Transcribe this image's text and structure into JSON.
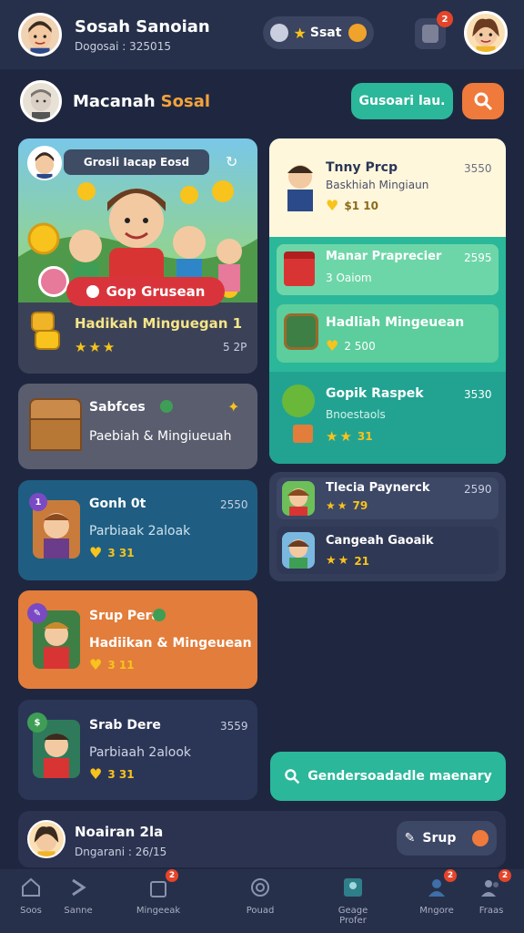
{
  "header": {
    "title": "Sosah Sanoian",
    "subtitle": "Dogosai : 325015",
    "status_chip": "Ssat",
    "notif_count": "2"
  },
  "section": {
    "title_main": "Macanah",
    "title_accent": "Sosal",
    "action_button": "Gusoari lau."
  },
  "feature_card": {
    "tag": "Grosli Iacap Eosd",
    "cta": "Gop Grusean",
    "title": "Hadikah Minguegan 1",
    "meta": "5 2P"
  },
  "left_cards": [
    {
      "title": "Sabfces",
      "desc": "Paebiah & Mingiueuah",
      "color": "#5a5d6e"
    },
    {
      "title": "Gonh 0t",
      "sub": "Parbiaak 2aloak",
      "meta": "2550",
      "rating": "3 31",
      "badge": "1",
      "color": "#1f5e82"
    },
    {
      "title": "Srup Pera",
      "sub": "Hadiikan & Mingeuean",
      "rating": "3 11",
      "color": "#e27d3b"
    },
    {
      "title": "Srab Dere",
      "sub": "Parbiaah 2alook",
      "meta": "3559",
      "rating": "3 31",
      "color": "#2b3657"
    }
  ],
  "right_panel": {
    "top": {
      "title": "Tnny Prcp",
      "sub": "Baskhiah Mingiaun",
      "rating": "$1 10",
      "meta": "3550"
    },
    "items": [
      {
        "title": "Manar Praprecier",
        "sub": "3 Oaiom",
        "meta": "2595"
      },
      {
        "title": "Hadliah Mingeuean",
        "sub": "2 500"
      },
      {
        "title": "Gopik Raspek",
        "sub": "Bnoestaols",
        "rating": "31",
        "meta": "3530"
      }
    ],
    "lower": [
      {
        "title": "Tlecia Paynerck",
        "rating": "79",
        "meta": "2590"
      },
      {
        "title": "Cangeah Gaoaik",
        "rating": "21"
      }
    ]
  },
  "cta_button": "Gendersoadadle maenary",
  "profile_bar": {
    "name": "Noairan 2la",
    "subtitle": "Dngarani : 26/15",
    "button": "Srup"
  },
  "bottom_nav": [
    {
      "label": "Soos",
      "icon": "home-icon"
    },
    {
      "label": "Sanne",
      "icon": "share-icon"
    },
    {
      "label": "Mingeeak",
      "icon": "gift-icon",
      "badge": "2"
    },
    {
      "label": "Pouad",
      "icon": "search-icon"
    },
    {
      "label": "Geage Profer",
      "icon": "profile-card-icon"
    },
    {
      "label": "Mngore",
      "icon": "user-icon",
      "badge": "2"
    },
    {
      "label": "Fraas",
      "icon": "friends-icon",
      "badge": "2"
    }
  ],
  "colors": {
    "background": "#1f2740",
    "accent_teal": "#2bb79a",
    "accent_orange": "#ef7a3c",
    "star": "#f7c31c"
  }
}
